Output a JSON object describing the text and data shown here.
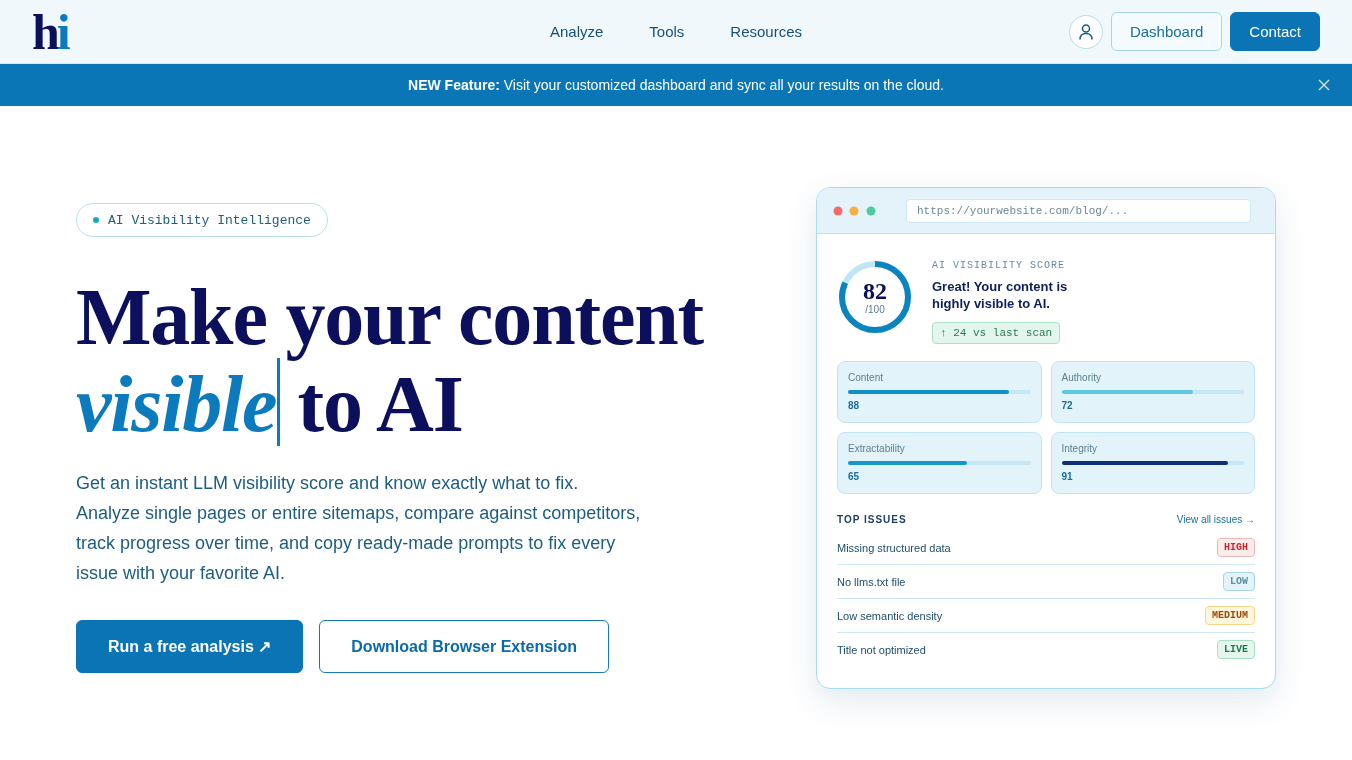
{
  "header": {
    "logo": "hi",
    "nav": [
      "Analyze",
      "Tools",
      "Resources"
    ],
    "buttons": [
      {
        "label": "Dashboard",
        "kind": "outline"
      },
      {
        "label": "Contact",
        "kind": "primary"
      }
    ]
  },
  "banner": {
    "text": "**NEW Feature:** Visit your customized dashboard and sync all your results on the cloud."
  },
  "hero": {
    "badge": "AI Visibility Intelligence",
    "heading": [
      {
        "text": "Make your content",
        "kind": "plain"
      },
      {
        "text": "visible",
        "kind": "highlight"
      },
      {
        "text": "to AI",
        "kind": "plain"
      }
    ],
    "description": [
      "Get an instant LLM visibility score and know exactly what to fix.",
      "Analyze single pages or entire sitemaps, compare against competitors,",
      "track progress over time, and copy ready-made prompts to fix every",
      "issue with your favorite AI."
    ],
    "buttons": [
      {
        "label": "Run a free analysis ↗",
        "kind": "primary"
      },
      {
        "label": "Download Browser Extension",
        "kind": "outline"
      }
    ]
  },
  "preview": {
    "url": "https://yourwebsite.com/blog/...",
    "score": {
      "value": "82",
      "max": "/100",
      "level": 0.82,
      "label": "AI VISIBILITY SCORE",
      "message": "Great! Your content is highly visible to AI.",
      "delta": "↑ 24 vs last scan"
    },
    "metrics": [
      {
        "name": "Content",
        "value": "88",
        "level": 0.88,
        "color": "#0f8fc8"
      },
      {
        "name": "Authority",
        "value": "72",
        "level": 0.72,
        "color": "#5cc9e2"
      },
      {
        "name": "Extractability",
        "value": "65",
        "level": 0.65,
        "color": "#1596cc"
      },
      {
        "name": "Integrity",
        "value": "91",
        "level": 0.91,
        "color": "#0c2f78"
      }
    ],
    "issues_title": "TOP ISSUES",
    "view_all": "View all issues →",
    "issues": [
      {
        "text": "Missing structured data",
        "badge": "HIGH",
        "kind": "high"
      },
      {
        "text": "No llms.txt file",
        "badge": "LOW",
        "kind": "low"
      },
      {
        "text": "Low semantic density",
        "badge": "MEDIUM",
        "kind": "medium"
      },
      {
        "text": "Title not optimized",
        "badge": "LIVE",
        "kind": "live"
      }
    ]
  }
}
